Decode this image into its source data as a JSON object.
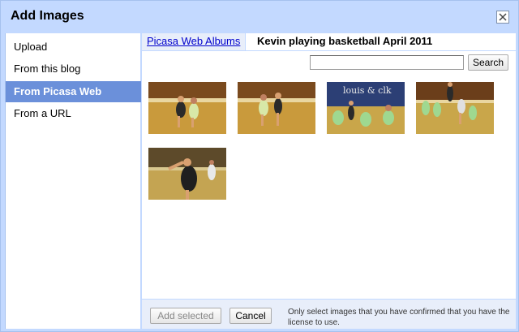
{
  "dialog": {
    "title": "Add Images",
    "close_icon": "close-icon"
  },
  "sidebar": {
    "items": [
      {
        "label": "Upload"
      },
      {
        "label": "From this blog"
      },
      {
        "label": "From Picasa Web Albums",
        "selected": true
      },
      {
        "label": "From a URL"
      }
    ]
  },
  "breadcrumb": {
    "link": "Picasa Web Albums",
    "current": "Kevin playing basketball April 2011"
  },
  "search": {
    "value": "",
    "button_label": "Search"
  },
  "photos": [
    {
      "name": "basketball-photo-1"
    },
    {
      "name": "basketball-photo-2"
    },
    {
      "name": "basketball-photo-3"
    },
    {
      "name": "basketball-photo-4"
    },
    {
      "name": "basketball-photo-5"
    }
  ],
  "footer": {
    "add_selected_label": "Add selected",
    "cancel_label": "Cancel",
    "note": "Only select images that you have confirmed that you have the license to use."
  },
  "colors": {
    "frame": "#c3d9ff",
    "selected": "#6b90da",
    "link": "#0000cc"
  }
}
